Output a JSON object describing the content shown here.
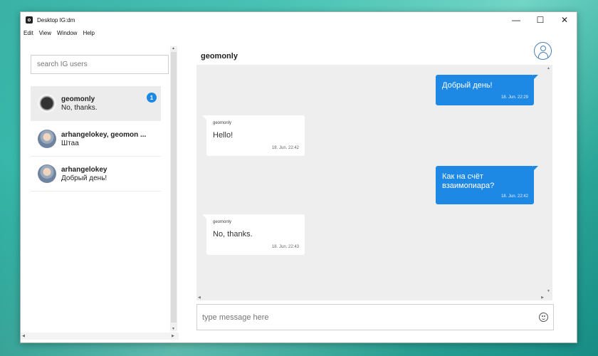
{
  "window": {
    "title": "Desktop IG:dm",
    "controls": {
      "minimize": "—",
      "maximize": "☐",
      "close": "✕"
    }
  },
  "menu": [
    "Edit",
    "View",
    "Window",
    "Help"
  ],
  "sidebar": {
    "search_placeholder": "search IG users",
    "conversations": [
      {
        "name": "geomonly",
        "last": "No, thanks.",
        "unread": "1",
        "active": true,
        "avatar_icon": "dark-avatar"
      },
      {
        "name": "arhangelokey, geomon ...",
        "last": "Штаа",
        "active": false,
        "avatar_icon": "photo-avatar"
      },
      {
        "name": "arhangelokey",
        "last": "Добрый день!",
        "active": false,
        "avatar_icon": "photo-avatar"
      }
    ]
  },
  "chat": {
    "title": "geomonly",
    "messages": [
      {
        "dir": "out",
        "text": "Добрый день!",
        "time": "18. Jun. 22:29"
      },
      {
        "dir": "in",
        "sender": "geomonly",
        "text": "Hello!",
        "time": "18. Jun. 22:42"
      },
      {
        "dir": "out",
        "text": "Как на счёт взаимопиара?",
        "time": "18. Jun. 22:42"
      },
      {
        "dir": "in",
        "sender": "geomonly",
        "text": "No, thanks.",
        "time": "18. Jun. 22:43"
      }
    ],
    "composer_placeholder": "type message here"
  },
  "colors": {
    "accent": "#1e88e5",
    "thread_bg": "#eeeeee"
  }
}
